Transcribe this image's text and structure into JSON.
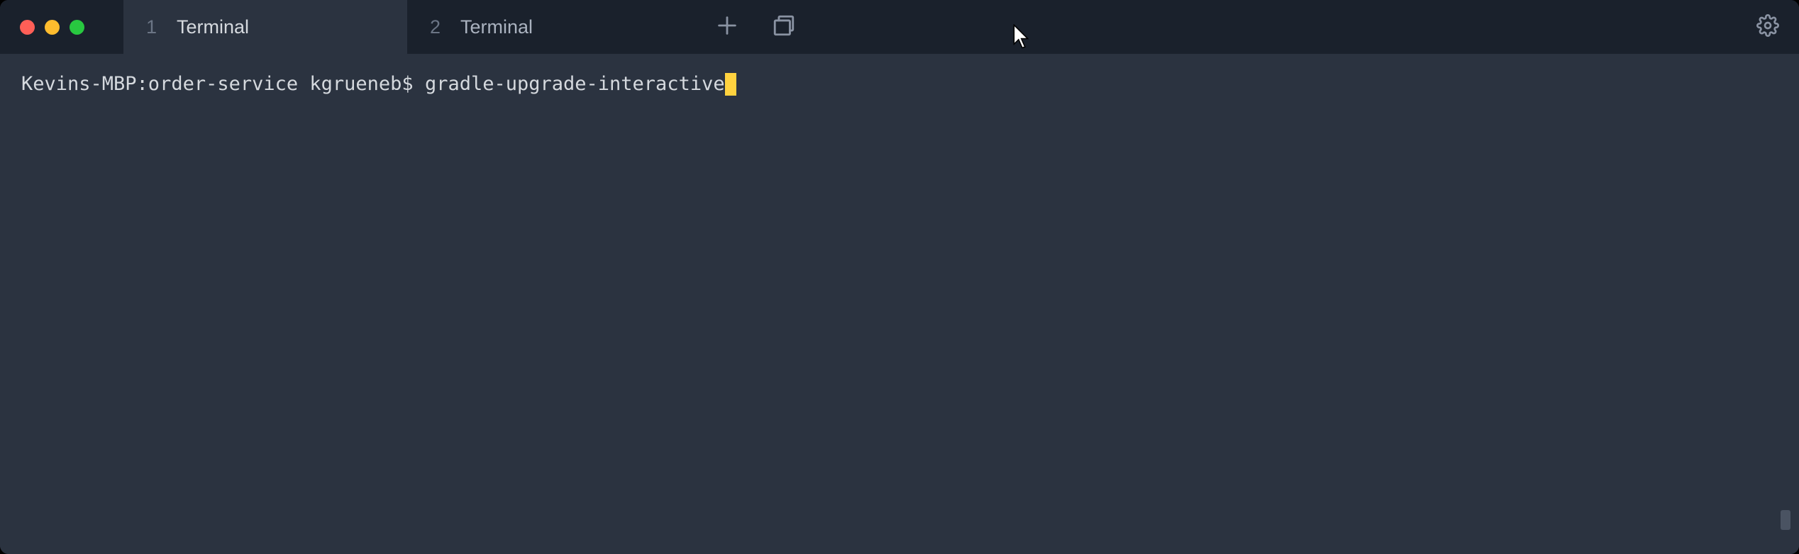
{
  "tabs": [
    {
      "number": "1",
      "label": "Terminal",
      "active": true
    },
    {
      "number": "2",
      "label": "Terminal",
      "active": false
    }
  ],
  "terminal": {
    "prompt": "Kevins-MBP:order-service kgrueneb$ ",
    "command": "gradle-upgrade-interactive"
  }
}
